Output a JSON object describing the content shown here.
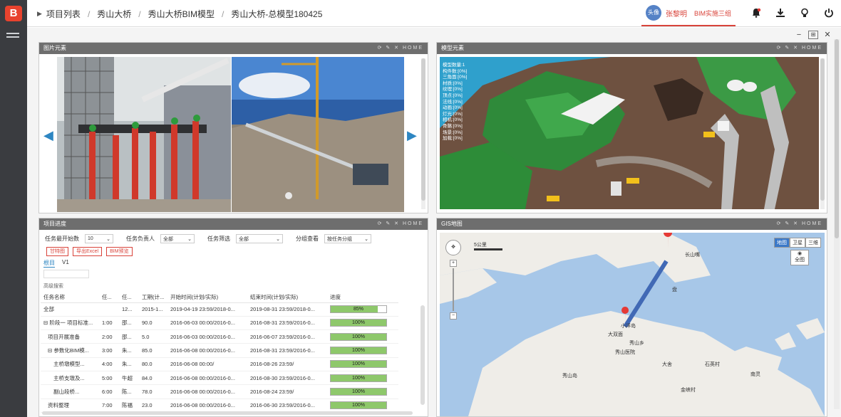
{
  "app": {
    "logo_text": "B"
  },
  "breadcrumb": [
    "项目列表",
    "秀山大桥",
    "秀山大桥BIM模型",
    "秀山大桥-总模型180425"
  ],
  "user": {
    "avatar_text": "头像",
    "name": "张黎明",
    "project": "BIM实施三组"
  },
  "toolbar_icons": [
    "bell-icon",
    "download-icon",
    "bulb-icon",
    "power-icon"
  ],
  "panels": {
    "image": {
      "title": "图片元素",
      "tools": "⟳ ✎ ✕ HOME"
    },
    "model": {
      "title": "模型元素",
      "tools": "⟳ ✎ ✕ HOME"
    },
    "progress": {
      "title": "项目进度",
      "tools": "⟳ ✎ ✕ HOME"
    },
    "gis": {
      "title": "GIS地图",
      "tools": "⟳ ✎ ✕ HOME"
    }
  },
  "progress": {
    "filters": {
      "start_label": "任务最开始数",
      "start_value": "10",
      "owner_label": "任务负责人",
      "owner_value": "全部",
      "filter_label": "任务筛选",
      "filter_value": "全部",
      "group_label": "分组查看",
      "group_value": "按任务分组"
    },
    "buttons": [
      "甘特图",
      "导出Excel",
      "BIM预览"
    ],
    "tabs": [
      "根目",
      "V1"
    ],
    "advanced": "高级搜索",
    "columns": [
      "任务名称",
      "任...",
      "任...",
      "工期(计...",
      "开始时间(计划/实际)",
      "结束时间(计划/实际)",
      "进度"
    ],
    "rows": [
      {
        "name": "全部",
        "a": "",
        "b": "12...",
        "d": "2015-1...",
        "s": "2019-04-19 23:59/2018-0...",
        "e": "2019-08-31 23:59/2018-0...",
        "p": "85%",
        "pv": 0.85
      },
      {
        "name": "⊟ 阶段一 项目标准...",
        "a": "1:00",
        "b": "邵...",
        "d": "90.0",
        "s": "2016-06-03 00:00/2016-0...",
        "e": "2016-08-31 23:59/2016-0...",
        "p": "100%",
        "pv": 1
      },
      {
        "name": "项目开展准备",
        "a": "2:00",
        "b": "邵...",
        "d": "5.0",
        "s": "2016-06-03 00:00/2016-0...",
        "e": "2016-06-07 23:59/2016-0...",
        "p": "100%",
        "pv": 1
      },
      {
        "name": "⊟ 参数化BIM模...",
        "a": "3:00",
        "b": "朱...",
        "d": "85.0",
        "s": "2016-06-08 00:00/2016-0...",
        "e": "2016-08-31 23:59/2016-0...",
        "p": "100%",
        "pv": 1
      },
      {
        "name": "主桥墩模型...",
        "a": "4:00",
        "b": "朱...",
        "d": "80.0",
        "s": "2016-06-08 00:00/",
        "e": "2016-08-26 23:59/",
        "p": "100%",
        "pv": 1
      },
      {
        "name": "主桥支墩及...",
        "a": "5:00",
        "b": "牛超",
        "d": "84.0",
        "s": "2016-06-08 00:00/2016-0...",
        "e": "2016-08-30 23:59/2016-0...",
        "p": "100%",
        "pv": 1
      },
      {
        "name": "副山段桥...",
        "a": "6:00",
        "b": "陈...",
        "d": "78.0",
        "s": "2016-06-08 00:00/2016-0...",
        "e": "2016-08-24 23:59/",
        "p": "100%",
        "pv": 1
      },
      {
        "name": "资料整理",
        "a": "7:00",
        "b": "陈福",
        "d": "23.0",
        "s": "2016-06-08 00:00/2016-0...",
        "e": "2016-06-30 23:59/2016-0...",
        "p": "100%",
        "pv": 1
      }
    ]
  },
  "gis": {
    "scale": "5公里",
    "map_types": [
      "地图",
      "卫星",
      "三维"
    ],
    "fullview": "全图",
    "labels": [
      "秀山乡",
      "小洋岛",
      "大双面",
      "秀山岛",
      "盘",
      "长山嘴",
      "秀山医院",
      "大舍",
      "石英村",
      "金峡村",
      "南灵"
    ]
  },
  "model_overlay": [
    "模型数量:1",
    "构件数:[0%]",
    "三角面:[0%]",
    "材质:[0%]",
    "纹理:[0%]",
    "顶点:[0%]",
    "法线:[0%]",
    "动画:[0%]",
    "灯光:[0%]",
    "相机:[0%]",
    "骨骼:[0%]",
    "场景:[0%]",
    "加载:[0%]"
  ]
}
